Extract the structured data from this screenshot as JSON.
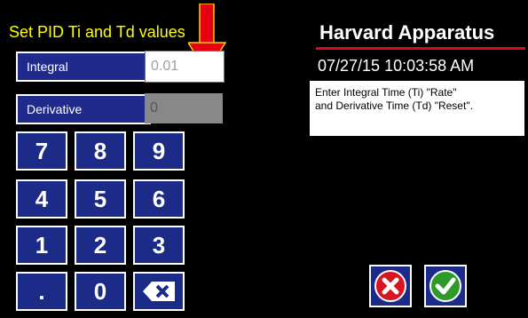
{
  "screen": {
    "title": "Set PID Ti and Td values"
  },
  "fields": {
    "integral": {
      "label": "Integral",
      "value": "0.01"
    },
    "derivative": {
      "label": "Derivative",
      "value": "0"
    }
  },
  "keypad": {
    "keys": [
      "7",
      "8",
      "9",
      "4",
      "5",
      "6",
      "1",
      "2",
      "3",
      ".",
      "0"
    ],
    "backspace_icon": "backspace-icon"
  },
  "header": {
    "brand": "Harvard Apparatus",
    "datetime": "07/27/15 10:03:58 AM"
  },
  "help": {
    "line1": "Enter Integral Time (Ti) \"Rate\"",
    "line2": "and Derivative Time (Td) \"Reset\"."
  },
  "actions": {
    "cancel_icon": "cancel-icon",
    "confirm_icon": "confirm-check-icon"
  },
  "colors": {
    "title": "#ffff00",
    "button_fill": "#1c2a88",
    "arrow": "#e60012",
    "brand_rule": "#e30613"
  }
}
